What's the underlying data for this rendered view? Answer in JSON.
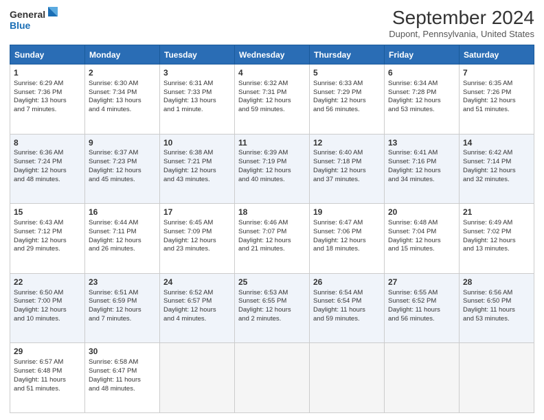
{
  "header": {
    "logo_line1": "General",
    "logo_line2": "Blue",
    "month": "September 2024",
    "location": "Dupont, Pennsylvania, United States"
  },
  "days_of_week": [
    "Sunday",
    "Monday",
    "Tuesday",
    "Wednesday",
    "Thursday",
    "Friday",
    "Saturday"
  ],
  "weeks": [
    [
      {
        "day": 1,
        "info": "Sunrise: 6:29 AM\nSunset: 7:36 PM\nDaylight: 13 hours\nand 7 minutes."
      },
      {
        "day": 2,
        "info": "Sunrise: 6:30 AM\nSunset: 7:34 PM\nDaylight: 13 hours\nand 4 minutes."
      },
      {
        "day": 3,
        "info": "Sunrise: 6:31 AM\nSunset: 7:33 PM\nDaylight: 13 hours\nand 1 minute."
      },
      {
        "day": 4,
        "info": "Sunrise: 6:32 AM\nSunset: 7:31 PM\nDaylight: 12 hours\nand 59 minutes."
      },
      {
        "day": 5,
        "info": "Sunrise: 6:33 AM\nSunset: 7:29 PM\nDaylight: 12 hours\nand 56 minutes."
      },
      {
        "day": 6,
        "info": "Sunrise: 6:34 AM\nSunset: 7:28 PM\nDaylight: 12 hours\nand 53 minutes."
      },
      {
        "day": 7,
        "info": "Sunrise: 6:35 AM\nSunset: 7:26 PM\nDaylight: 12 hours\nand 51 minutes."
      }
    ],
    [
      {
        "day": 8,
        "info": "Sunrise: 6:36 AM\nSunset: 7:24 PM\nDaylight: 12 hours\nand 48 minutes."
      },
      {
        "day": 9,
        "info": "Sunrise: 6:37 AM\nSunset: 7:23 PM\nDaylight: 12 hours\nand 45 minutes."
      },
      {
        "day": 10,
        "info": "Sunrise: 6:38 AM\nSunset: 7:21 PM\nDaylight: 12 hours\nand 43 minutes."
      },
      {
        "day": 11,
        "info": "Sunrise: 6:39 AM\nSunset: 7:19 PM\nDaylight: 12 hours\nand 40 minutes."
      },
      {
        "day": 12,
        "info": "Sunrise: 6:40 AM\nSunset: 7:18 PM\nDaylight: 12 hours\nand 37 minutes."
      },
      {
        "day": 13,
        "info": "Sunrise: 6:41 AM\nSunset: 7:16 PM\nDaylight: 12 hours\nand 34 minutes."
      },
      {
        "day": 14,
        "info": "Sunrise: 6:42 AM\nSunset: 7:14 PM\nDaylight: 12 hours\nand 32 minutes."
      }
    ],
    [
      {
        "day": 15,
        "info": "Sunrise: 6:43 AM\nSunset: 7:12 PM\nDaylight: 12 hours\nand 29 minutes."
      },
      {
        "day": 16,
        "info": "Sunrise: 6:44 AM\nSunset: 7:11 PM\nDaylight: 12 hours\nand 26 minutes."
      },
      {
        "day": 17,
        "info": "Sunrise: 6:45 AM\nSunset: 7:09 PM\nDaylight: 12 hours\nand 23 minutes."
      },
      {
        "day": 18,
        "info": "Sunrise: 6:46 AM\nSunset: 7:07 PM\nDaylight: 12 hours\nand 21 minutes."
      },
      {
        "day": 19,
        "info": "Sunrise: 6:47 AM\nSunset: 7:06 PM\nDaylight: 12 hours\nand 18 minutes."
      },
      {
        "day": 20,
        "info": "Sunrise: 6:48 AM\nSunset: 7:04 PM\nDaylight: 12 hours\nand 15 minutes."
      },
      {
        "day": 21,
        "info": "Sunrise: 6:49 AM\nSunset: 7:02 PM\nDaylight: 12 hours\nand 13 minutes."
      }
    ],
    [
      {
        "day": 22,
        "info": "Sunrise: 6:50 AM\nSunset: 7:00 PM\nDaylight: 12 hours\nand 10 minutes."
      },
      {
        "day": 23,
        "info": "Sunrise: 6:51 AM\nSunset: 6:59 PM\nDaylight: 12 hours\nand 7 minutes."
      },
      {
        "day": 24,
        "info": "Sunrise: 6:52 AM\nSunset: 6:57 PM\nDaylight: 12 hours\nand 4 minutes."
      },
      {
        "day": 25,
        "info": "Sunrise: 6:53 AM\nSunset: 6:55 PM\nDaylight: 12 hours\nand 2 minutes."
      },
      {
        "day": 26,
        "info": "Sunrise: 6:54 AM\nSunset: 6:54 PM\nDaylight: 11 hours\nand 59 minutes."
      },
      {
        "day": 27,
        "info": "Sunrise: 6:55 AM\nSunset: 6:52 PM\nDaylight: 11 hours\nand 56 minutes."
      },
      {
        "day": 28,
        "info": "Sunrise: 6:56 AM\nSunset: 6:50 PM\nDaylight: 11 hours\nand 53 minutes."
      }
    ],
    [
      {
        "day": 29,
        "info": "Sunrise: 6:57 AM\nSunset: 6:48 PM\nDaylight: 11 hours\nand 51 minutes."
      },
      {
        "day": 30,
        "info": "Sunrise: 6:58 AM\nSunset: 6:47 PM\nDaylight: 11 hours\nand 48 minutes."
      },
      {
        "day": null,
        "info": ""
      },
      {
        "day": null,
        "info": ""
      },
      {
        "day": null,
        "info": ""
      },
      {
        "day": null,
        "info": ""
      },
      {
        "day": null,
        "info": ""
      }
    ]
  ]
}
